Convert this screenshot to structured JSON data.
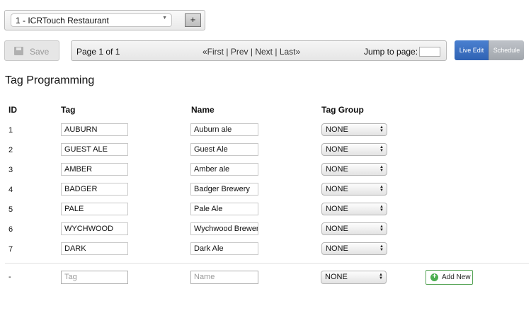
{
  "site_selector": {
    "selected": "1 - ICRTouch Restaurant",
    "add_label": "+"
  },
  "toolbar": {
    "save_label": "Save"
  },
  "pager": {
    "page_info": "Page 1 of 1",
    "first": "«First",
    "prev": "Prev",
    "next": "Next",
    "last": "Last»",
    "separator": "|",
    "jump_label": "Jump to page:",
    "jump_value": ""
  },
  "mode": {
    "live_label": "Live Edit",
    "schedule_label": "Schedule",
    "active": "live"
  },
  "page_title": "Tag Programming",
  "table": {
    "headers": {
      "id": "ID",
      "tag": "Tag",
      "name": "Name",
      "group": "Tag Group"
    },
    "rows": [
      {
        "id": "1",
        "tag": "AUBURN",
        "name": "Auburn ale",
        "group": "NONE"
      },
      {
        "id": "2",
        "tag": "GUEST ALE",
        "name": "Guest Ale",
        "group": "NONE"
      },
      {
        "id": "3",
        "tag": "AMBER",
        "name": "Amber ale",
        "group": "NONE"
      },
      {
        "id": "4",
        "tag": "BADGER",
        "name": "Badger Brewery",
        "group": "NONE"
      },
      {
        "id": "5",
        "tag": "PALE",
        "name": "Pale Ale",
        "group": "NONE"
      },
      {
        "id": "6",
        "tag": "WYCHWOOD",
        "name": "Wychwood Brewery",
        "group": "NONE"
      },
      {
        "id": "7",
        "tag": "DARK",
        "name": "Dark Ale",
        "group": "NONE"
      }
    ],
    "new_row": {
      "id": "-",
      "tag_placeholder": "Tag",
      "name_placeholder": "Name",
      "group": "NONE",
      "add_label": "Add New"
    }
  },
  "colors": {
    "live_edit": "#3a6fc4",
    "schedule": "#b0b4ba",
    "add_new_border": "#5aa65a"
  }
}
